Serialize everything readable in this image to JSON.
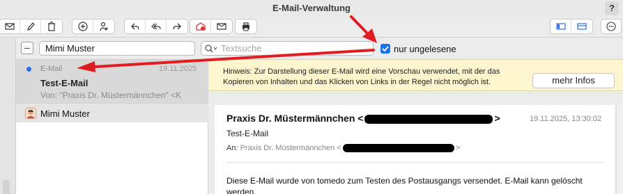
{
  "window": {
    "title": "E-Mail-Verwaltung",
    "help": "?"
  },
  "toolbar": {
    "groups": [
      {
        "id": "g1",
        "icons": [
          "compose-icon",
          "edit-icon",
          "delete-icon"
        ]
      },
      {
        "id": "g2",
        "icons": [
          "add-icon",
          "assign-person-icon"
        ]
      },
      {
        "id": "g3",
        "icons": [
          "reply-icon",
          "reply-all-icon",
          "forward-icon"
        ]
      },
      {
        "id": "g4",
        "icons": [
          "mark-unread-icon",
          "mark-read-icon"
        ]
      },
      {
        "id": "g5",
        "icons": [
          "print-icon"
        ]
      },
      {
        "id": "g6",
        "icons": [
          "layout-left-icon",
          "layout-split-icon"
        ]
      },
      {
        "id": "g7",
        "icons": [
          "more-icon"
        ]
      }
    ]
  },
  "filter": {
    "contact": "Mimi Muster",
    "search_placeholder": "Textsuche",
    "only_unread_label": "nur ungelesene",
    "only_unread_checked": true
  },
  "list": {
    "selected": {
      "from_label": "E-Mail",
      "date": "19.11.2025",
      "subject": "Test-E-Mail",
      "sender": "Von: \"Praxis Dr. Müstermännchen\" <K"
    },
    "contact": {
      "name": "Mimi Muster"
    }
  },
  "hint": {
    "text": "Hinweis: Zur Darstellung dieser E-Mail wird eine Vorschau verwendet, mit der das Kopieren von Inhalten und das Klicken von Links in der Regel nicht möglich ist.",
    "button": "mehr Infos"
  },
  "mail": {
    "from_name": "Praxis Dr. Müstermännchen <",
    "from_close": ">",
    "date": "19.11.2025, 13:30:02",
    "subject": "Test-E-Mail",
    "to_label": "An:",
    "to_name": "Praxis Dr. Müstermännchen <",
    "to_close": ">",
    "body": "Diese E-Mail wurde von tomedo zum Testen des Postausgangs versendet. E-Mail kann gelöscht werden."
  },
  "colors": {
    "accent": "#1a73e8",
    "annotation": "#e01e22",
    "unread_dot": "#2f6fdc",
    "hint_bg": "#fdf5cd"
  }
}
